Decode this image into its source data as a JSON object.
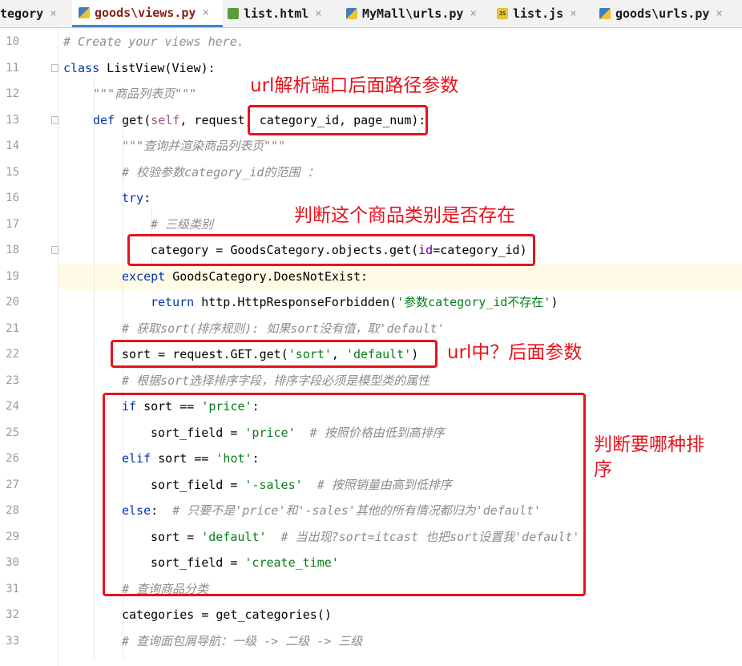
{
  "tabs": [
    {
      "label": "tegory",
      "close": "×"
    },
    {
      "label": "goods\\views.py",
      "close": "×",
      "icon": "python-file-icon",
      "active": true
    },
    {
      "label": "list.html",
      "close": "×",
      "icon": "html-file-icon"
    },
    {
      "label": "MyMall\\urls.py",
      "close": "×",
      "icon": "python-file-icon"
    },
    {
      "label": "list.js",
      "close": "×",
      "icon": "js-file-icon"
    },
    {
      "label": "goods\\urls.py",
      "close": "×",
      "icon": "python-file-icon"
    }
  ],
  "js_icon_text": "JS",
  "line_numbers": [
    "10",
    "11",
    "12",
    "13",
    "14",
    "15",
    "16",
    "17",
    "18",
    "19",
    "20",
    "21",
    "22",
    "23",
    "24",
    "25",
    "26",
    "27",
    "28",
    "29",
    "30",
    "31",
    "32",
    "33"
  ],
  "code": {
    "l10_comment": "# Create your views here.",
    "l11_kw": "class",
    "l11_name": " ListView(View):",
    "l12": "\"\"\"商品列表页\"\"\"",
    "l13_kw": "def",
    "l13_a": " get(",
    "l13_self": "self",
    "l13_b": ", request, category_id, page_num):",
    "l14": "\"\"\"查询并渲染商品列表页\"\"\"",
    "l15": "# 校验参数category_id的范围 ：",
    "l16_kw": "try",
    "l16_b": ":",
    "l17": "# 三级类别",
    "l18_a": "category = GoodsCategory.objects.get(",
    "l18_prm": "id",
    "l18_b": "=category_id)",
    "l19_kw": "except",
    "l19_b": " GoodsCategory.DoesNotExist:",
    "l20_kw": "return",
    "l20_a": " http.HttpResponseForbidden(",
    "l20_str": "'参数category_id不存在'",
    "l20_b": ")",
    "l21": "# 获取sort(排序规则): 如果sort没有值，取'default'",
    "l22_a": "sort = request.GET.get(",
    "l22_s1": "'sort'",
    "l22_c": ", ",
    "l22_s2": "'default'",
    "l22_b": ")",
    "l23": "# 根据sort选择排序字段，排序字段必须是模型类的属性",
    "l24_kw": "if",
    "l24_a": " sort == ",
    "l24_str": "'price'",
    "l24_b": ":",
    "l25_a": "sort_field = ",
    "l25_str": "'price'",
    "l25_cm": "  # 按照价格由低到高排序",
    "l26_kw": "elif",
    "l26_a": " sort == ",
    "l26_str": "'hot'",
    "l26_b": ":",
    "l27_a": "sort_field = ",
    "l27_str": "'-sales'",
    "l27_cm": "  # 按照销量由高到低排序",
    "l28_kw": "else",
    "l28_b": ":",
    "l28_cm": "  # 只要不是'price'和'-sales'其他的所有情况都归为'default'",
    "l29_a": "sort = ",
    "l29_str": "'default'",
    "l29_cm": "  # 当出现?sort=itcast 也把sort设置我'default'",
    "l30_a": "sort_field = ",
    "l30_str": "'create_time'",
    "l31": "# 查询商品分类",
    "l32": "categories = get_categories()",
    "l33": "# 查询面包屑导航：一级 -> 二级 -> 三级"
  },
  "annotations": {
    "url_params": "url解析端口后面路径参数",
    "check_category": "判断这个商品类别是否存在",
    "query_params": "url中？后面参数",
    "sort_choice_1": "判断要哪种排",
    "sort_choice_2": "序"
  },
  "colors": {
    "annotation_red": "#e8121c",
    "keyword": "#0033b3",
    "string": "#067d17",
    "comment": "#8c8c8c",
    "tab_accent": "#4083c9"
  }
}
